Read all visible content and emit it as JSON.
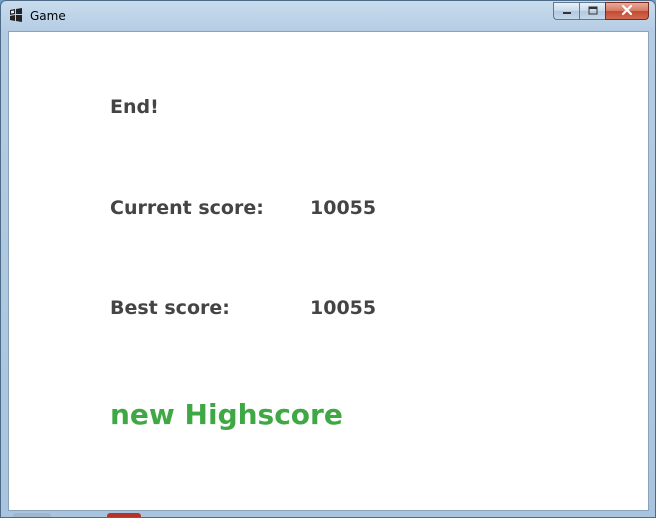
{
  "window": {
    "title": "Game",
    "icon": "game-app-icon",
    "buttons": {
      "minimize_icon": "minimize-icon",
      "maximize_icon": "maximize-icon",
      "close_icon": "close-icon"
    }
  },
  "game": {
    "end_label": "End!",
    "current_score_label": "Current score:",
    "current_score_value": "10055",
    "best_score_label": "Best score:",
    "best_score_value": "10055",
    "highscore_message": "new Highscore"
  },
  "colors": {
    "text": "#444444",
    "highscore": "#3fa845",
    "background": "#ffffff"
  }
}
